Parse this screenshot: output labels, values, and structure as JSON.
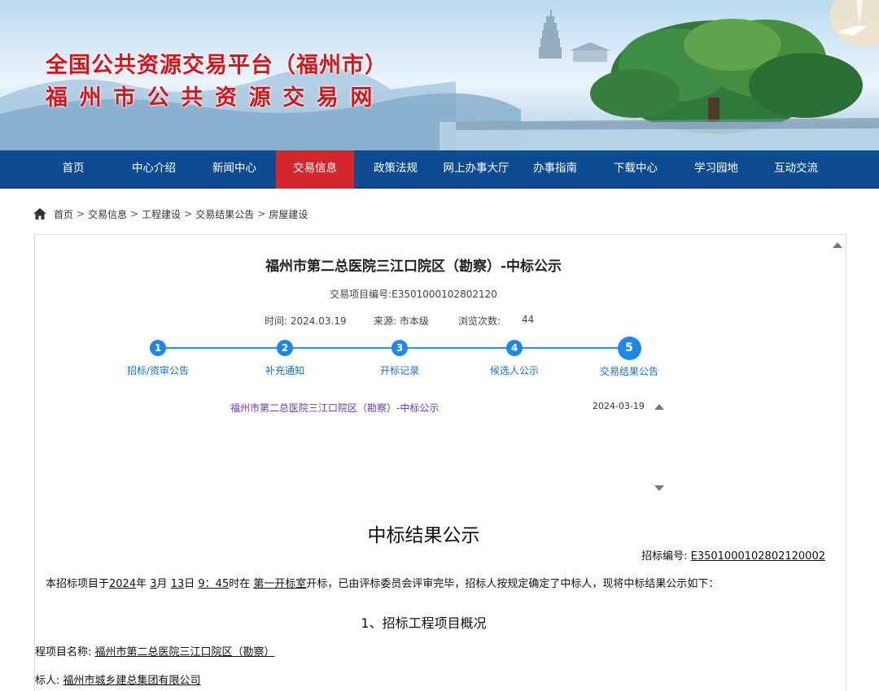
{
  "site": {
    "title": "全国公共资源交易平台（福州市）",
    "subtitle": "福州市公共资源交易网"
  },
  "nav": {
    "items": [
      "首页",
      "中心介绍",
      "新闻中心",
      "交易信息",
      "政策法规",
      "网上办事大厅",
      "办事指南",
      "下载中心",
      "学习园地",
      "互动交流"
    ],
    "active": "交易信息"
  },
  "breadcrumb": [
    "首页",
    "交易信息",
    "工程建设",
    "交易结果公告",
    "房屋建设"
  ],
  "article": {
    "title": "福州市第二总医院三江口院区（勘察）-中标公示",
    "project_code": "交易项目编号:E3501000102802120",
    "time_label": "时间:",
    "time": "2024.03.19",
    "source_label": "来源:",
    "source": "市本级",
    "views_label": "浏览次数:",
    "views": "44"
  },
  "steps": [
    {
      "num": "1",
      "label": "招标/资审公告"
    },
    {
      "num": "2",
      "label": "补充通知"
    },
    {
      "num": "3",
      "label": "开标记录"
    },
    {
      "num": "4",
      "label": "候选人公示"
    },
    {
      "num": "5",
      "label": "交易结果公告"
    }
  ],
  "related": {
    "link": "福州市第二总医院三江口院区（勘察）-中标公示",
    "date": "2024-03-19"
  },
  "content": {
    "heading": "中标结果公示",
    "bid_no_label": "招标编号:",
    "bid_no": "E3501000102802120002",
    "intro_prefix": "本招标项目于",
    "intro_year": "2024",
    "intro_year_suffix": "年",
    "intro_month": "3",
    "intro_month_suffix": "月",
    "intro_day": "13",
    "intro_day_suffix": "日",
    "intro_hour": "9：45",
    "intro_hour_suffix": "时在",
    "intro_room": "第一开标室",
    "intro_rest": "开标，已由评标委员会评审完毕，招标人按规定确定了中标人，现将中标结果公示如下：",
    "section1": "1、招标工程项目概况",
    "project_name_label": "程项目名称:",
    "project_name": "福州市第二总医院三江口院区（勘察）",
    "tenderer_label": "标人:",
    "tenderer": "福州市城乡建总集团有限公司"
  },
  "colors": {
    "nav_bg": "#0d4c93",
    "nav_active": "#d4262c",
    "title_red": "#d8141c",
    "step_blue": "#1f87ea",
    "link_purple": "#6a3aa8"
  }
}
